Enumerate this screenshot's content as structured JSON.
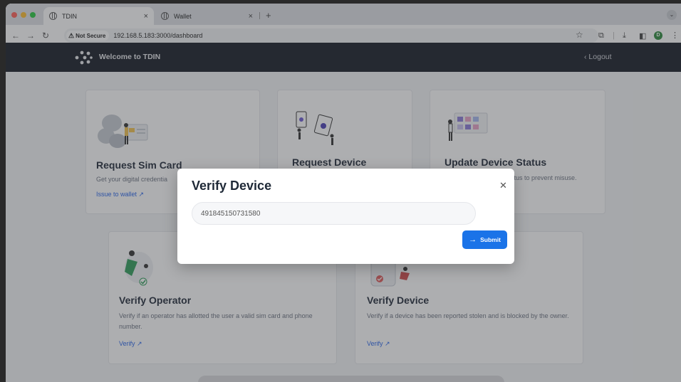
{
  "browser": {
    "tabs": [
      {
        "title": "TDIN",
        "active": true
      },
      {
        "title": "Wallet",
        "active": false
      }
    ],
    "security_label": "Not Secure",
    "url": "192.168.5.183:3000/dashboard",
    "profile_initial": "D"
  },
  "app": {
    "brand": "Welcome to TDIN",
    "logout_label": "Logout"
  },
  "cards": [
    {
      "title": "Request Sim Card",
      "description": "Get your digital credentia",
      "link": "Issue to wallet"
    },
    {
      "title": "Request Device",
      "description": "",
      "link": ""
    },
    {
      "title": "Update Device Status",
      "description": "tatus to prevent misuse.",
      "link": ""
    },
    {
      "title": "Verify Operator",
      "description": "Verify if an operator has allotted the user a valid sim card and phone number.",
      "link": "Verify"
    },
    {
      "title": "Verify Device",
      "description": "Verify if a device has been reported stolen and is blocked by the owner.",
      "link": "Verify"
    }
  ],
  "modal": {
    "title": "Verify Device",
    "input_value": "491845150731580",
    "submit_label": "Submit"
  },
  "colors": {
    "appbar": "#151a25",
    "accent": "#1a73e8",
    "link": "#2563eb"
  }
}
